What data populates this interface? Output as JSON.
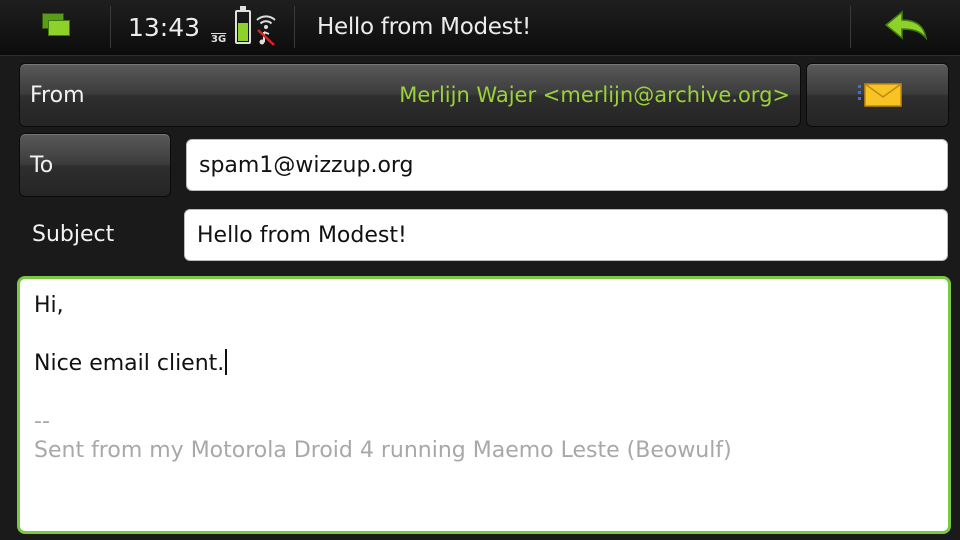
{
  "statusbar": {
    "time": "13:43",
    "network": "3G",
    "title": "Hello from Modest!"
  },
  "icons": {
    "switcher": "task-switcher-icon",
    "battery": "battery-icon",
    "signal": "signal-muted-icon",
    "back": "back-arrow-icon",
    "send": "send-mail-icon"
  },
  "colors": {
    "accent": "#7ac943",
    "from_value": "#9bd23a"
  },
  "form": {
    "from_label": "From",
    "from_value": "Merlijn Wajer <merlijn@archive.org>",
    "to_label": "To",
    "to_value": "spam1@wizzup.org",
    "subject_label": "Subject",
    "subject_value": "Hello from Modest!"
  },
  "body": {
    "greeting": "Hi,",
    "text": "Nice email client.",
    "sig_sep": "--",
    "signature": "Sent from my Motorola Droid 4 running Maemo Leste (Beowulf)"
  }
}
